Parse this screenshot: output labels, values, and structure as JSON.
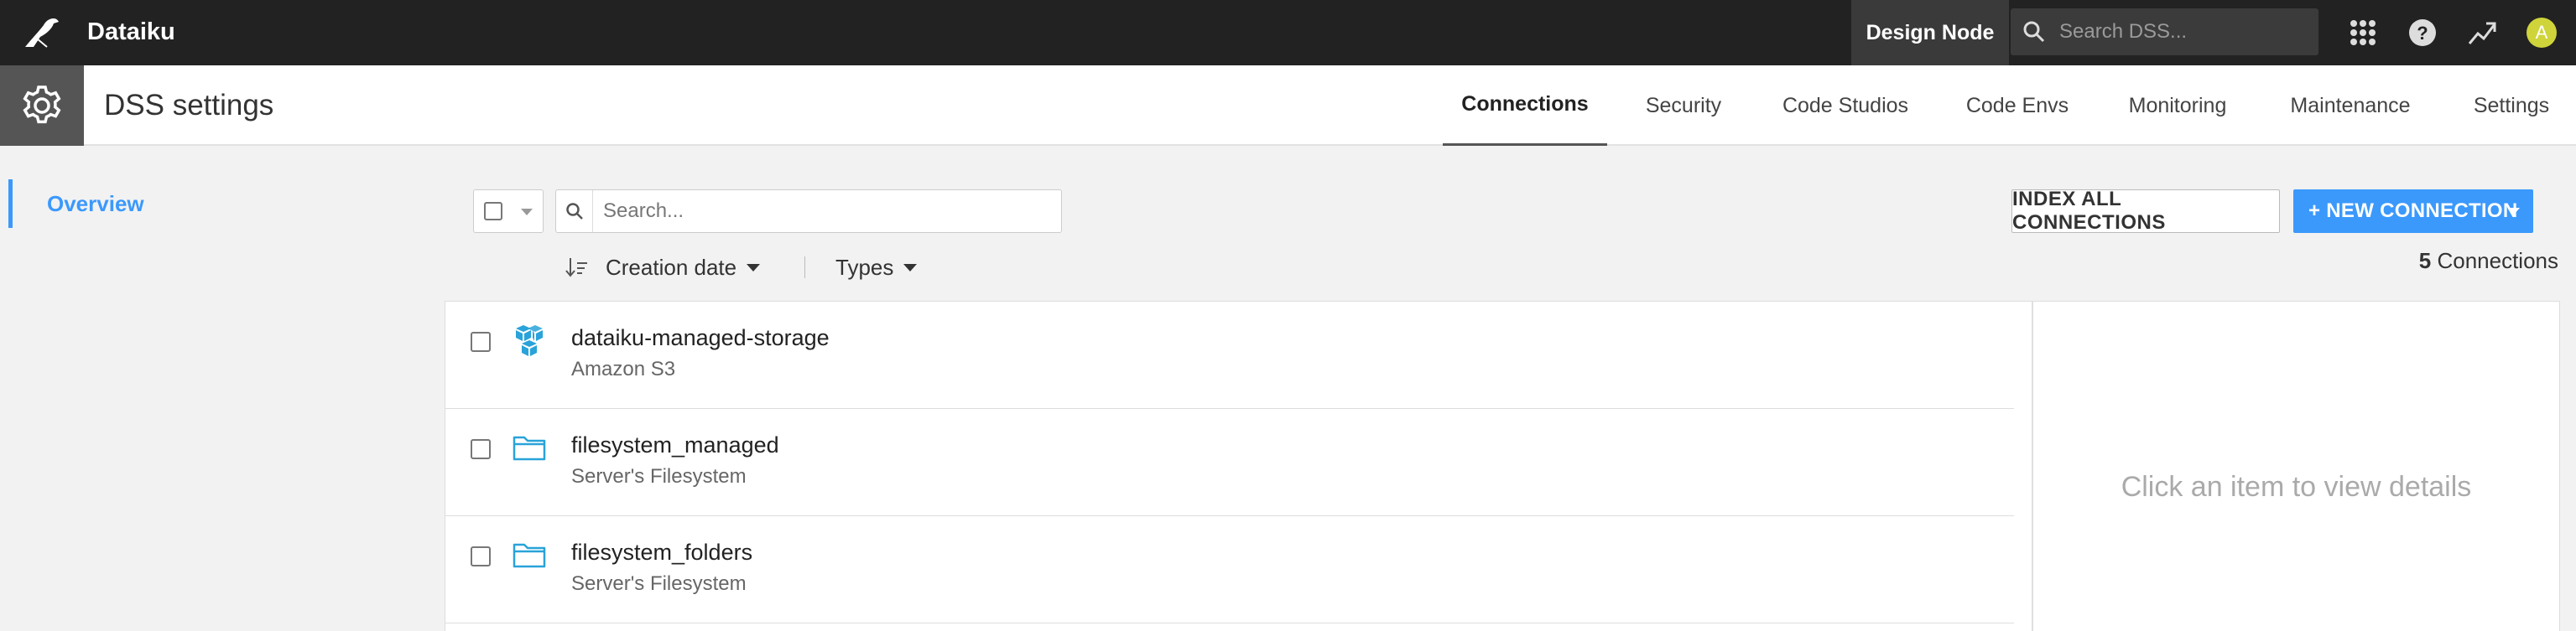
{
  "topbar": {
    "app_name": "Dataiku",
    "node": "Design Node",
    "search_placeholder": "Search DSS...",
    "avatar_letter": "A",
    "icons": [
      "bird-logo-icon",
      "search-icon",
      "apps-grid-icon",
      "help-icon",
      "trend-icon"
    ]
  },
  "header": {
    "title": "DSS settings",
    "tabs": [
      {
        "label": "Connections",
        "active": true
      },
      {
        "label": "Security"
      },
      {
        "label": "Code Studios"
      },
      {
        "label": "Code Envs"
      },
      {
        "label": "Monitoring"
      },
      {
        "label": "Maintenance"
      },
      {
        "label": "Settings"
      }
    ]
  },
  "sidebar": {
    "items": [
      {
        "label": "Overview",
        "active": true
      }
    ]
  },
  "toolbar": {
    "search_placeholder": "Search...",
    "sort_label": "Creation date",
    "types_label": "Types",
    "index_button": "INDEX ALL CONNECTIONS",
    "new_button": "+ NEW CONNECTION",
    "count": "5",
    "count_label": "Connections"
  },
  "connections": [
    {
      "name": "dataiku-managed-storage",
      "type": "Amazon S3",
      "icon": "s3-icon"
    },
    {
      "name": "filesystem_managed",
      "type": "Server's Filesystem",
      "icon": "folder-icon"
    },
    {
      "name": "filesystem_folders",
      "type": "Server's Filesystem",
      "icon": "folder-icon"
    }
  ],
  "detail": {
    "hint": "Click an item to view details"
  },
  "colors": {
    "accent": "#3b99fc",
    "topbar": "#222222",
    "icon_blue": "#29a3d9"
  }
}
